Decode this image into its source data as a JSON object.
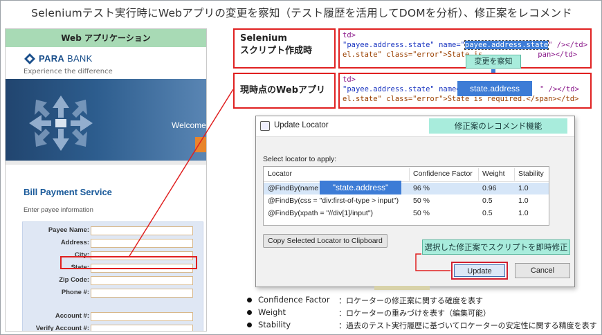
{
  "title": "Seleniumテスト実行時にWebアプリの変更を察知（テスト履歴を活用してDOMを分析）、修正案をレコメンド",
  "webapp": {
    "header": "Web アプリケーション",
    "logo_text_bold": "PARA",
    "logo_text": " BANK",
    "tagline": "Experience the difference",
    "welcome": "Welcome",
    "section_title": "Bill Payment Service",
    "section_sub": "Enter payee information",
    "form_labels": [
      "Payee Name:",
      "Address:",
      "City:",
      "State:",
      "Zip Code:",
      "Phone #:",
      "Account #:",
      "Verify Account #:"
    ]
  },
  "labels": {
    "script_line1": "Selenium",
    "script_line2": "スクリプト作成時",
    "current": "現時点のWebアプリ"
  },
  "code": {
    "before_line1_a": "td>",
    "before_line2_a": "\"payee.address.state\" name=\"",
    "before_line2_sel": "payee.address.state",
    "before_line2_b": "\" /></td>",
    "before_line3_a": "el.state\" class=\"error\">State is",
    "before_line3_b": "pan></td>",
    "after_line1_a": "td>",
    "after_line2_a": "\"payee.address.state\" name=\"",
    "after_line2_b": "\" /></td>",
    "after_line3": "el.state\" class=\"error\">State is required.</span></td>"
  },
  "detect_label": "変更を察知",
  "state_address": "state.address",
  "dialog": {
    "title": "Update Locator",
    "recommend_label": "修正案のレコメンド機能",
    "select_label": "Select locator to apply:",
    "columns": [
      "Locator",
      "Confidence Factor",
      "Weight",
      "Stability"
    ],
    "rows": [
      {
        "locator": "@FindBy(name = ",
        "confidence": "96 %",
        "weight": "0.96",
        "stability": "1.0"
      },
      {
        "locator": "@FindBy(css = \"div:first-of-type > input\")",
        "confidence": "50 %",
        "weight": "0.5",
        "stability": "1.0"
      },
      {
        "locator": "@FindBy(xpath = \"//div[1]/input\")",
        "confidence": "50 %",
        "weight": "0.5",
        "stability": "1.0"
      }
    ],
    "pill": "\"state.address\"",
    "copy_button": "Copy Selected Locator to Clipboard",
    "auto_fix": "選択した修正案でスクリプトを即時修正",
    "update_button": "Update",
    "cancel_button": "Cancel"
  },
  "legend": [
    {
      "term": "Confidence Factor",
      "def": "：ロケーターの修正案に関する確度を表す"
    },
    {
      "term": "Weight",
      "def": "：ロケーターの重みづけを表す（編集可能）"
    },
    {
      "term": "Stability",
      "def": "：過去のテスト実行履歴に基づいてロケーターの安定性に関する精度を表す"
    }
  ],
  "colors": {
    "accent_red": "#e02020",
    "teal_label": "#a8ecdc",
    "selection_blue": "#3d7cd6",
    "header_green": "#a8dab5"
  }
}
